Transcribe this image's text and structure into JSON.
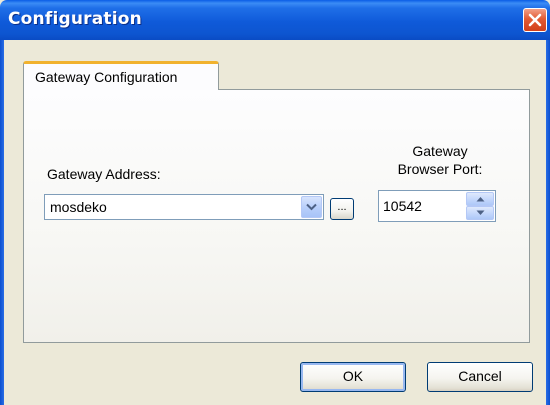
{
  "window": {
    "title": "Configuration"
  },
  "tabs": [
    {
      "label": "Gateway Configuration",
      "selected": true
    }
  ],
  "form": {
    "gateway_address_label": "Gateway Address:",
    "gateway_address_value": "mosdeko",
    "browse_label": "...",
    "port_label_line1": "Gateway",
    "port_label_line2": "Browser Port:",
    "port_value": "10542"
  },
  "buttons": {
    "ok_label": "OK",
    "cancel_label": "Cancel"
  },
  "icons": {
    "close": "close-icon",
    "dropdown": "chevron-down-icon",
    "spin_up": "spin-up-icon",
    "spin_down": "spin-down-icon"
  },
  "colors": {
    "titlebar": "#0f5ad9",
    "close_button": "#e35b34",
    "tab_highlight": "#f1b22e",
    "dialog_face": "#ece9d8"
  }
}
